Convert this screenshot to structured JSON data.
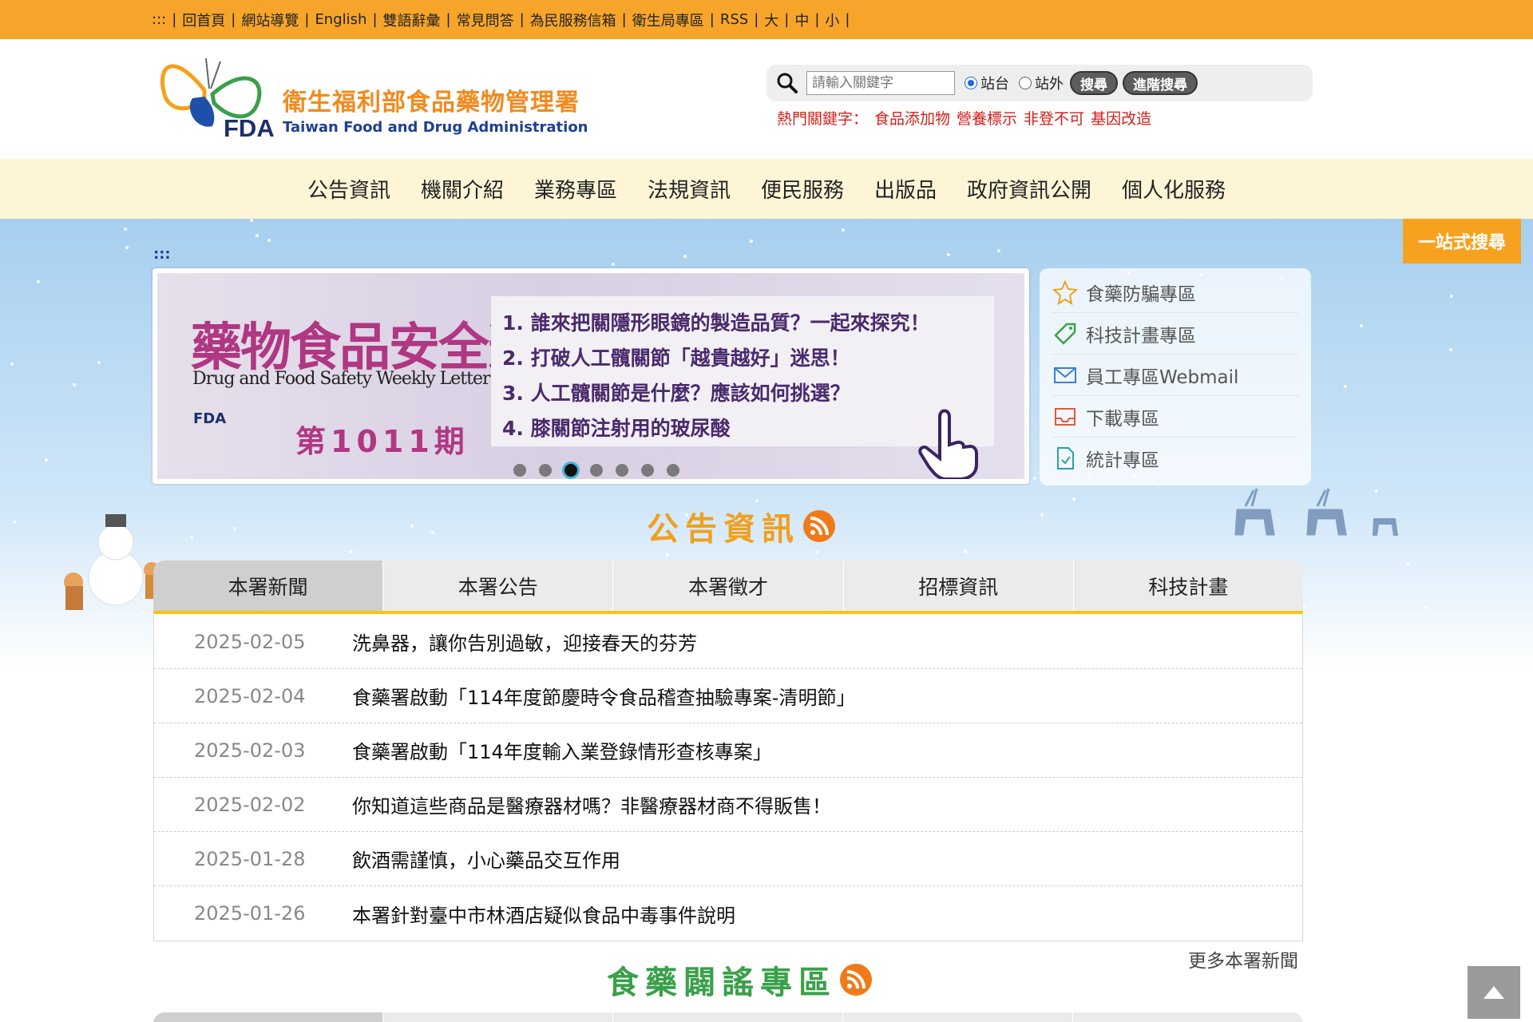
{
  "topbar": {
    "skip": ":::",
    "links": [
      "回首頁",
      "網站導覽",
      "English",
      "雙語辭彙",
      "常見問答",
      "為民服務信箱",
      "衛生局專區",
      "RSS",
      "大",
      "中",
      "小"
    ]
  },
  "logo": {
    "cn": "衛生福利部食品藥物管理署",
    "en": "Taiwan Food and Drug Administration",
    "fda": "FDA"
  },
  "search": {
    "placeholder": "請輸入關鍵字",
    "radio_site": "站台",
    "radio_external": "站外",
    "search_button": "搜尋",
    "advanced_button": "進階搜尋",
    "hot_label": "熱門關鍵字：",
    "hot_keywords": [
      "食品添加物",
      "營養標示",
      "非登不可",
      "基因改造"
    ]
  },
  "mainnav": [
    "公告資訊",
    "機關介紹",
    "業務專區",
    "法規資訊",
    "便民服務",
    "出版品",
    "政府資訊公開",
    "個人化服務"
  ],
  "skip_link": ":::",
  "onestop": "一站式搜尋",
  "banner": {
    "title": "藥物食品安全週報",
    "subtitle": "Drug and Food Safety Weekly Letter",
    "fda": "FDA",
    "issue": "第1011期",
    "items": [
      "1. 誰來把關隱形眼鏡的製造品質？一起來探究！",
      "2. 打破人工髖關節「越貴越好」迷思！",
      "3. 人工髖關節是什麼？應該如何挑選？",
      "4. 膝關節注射用的玻尿酸"
    ],
    "slide_count": 7,
    "active_slide": 3
  },
  "quicklinks": [
    {
      "label": "食藥防騙專區",
      "icon": "star-icon"
    },
    {
      "label": "科技計畫專區",
      "icon": "tag-icon"
    },
    {
      "label": "員工專區Webmail",
      "icon": "mail-icon"
    },
    {
      "label": "下載專區",
      "icon": "tray-icon"
    },
    {
      "label": "統計專區",
      "icon": "document-icon"
    }
  ],
  "announce": {
    "title": "公告資訊",
    "tabs": [
      "本署新聞",
      "本署公告",
      "本署徵才",
      "招標資訊",
      "科技計畫"
    ],
    "active_tab": 0,
    "news": [
      {
        "date": "2025-02-05",
        "title": "洗鼻器，讓你告別過敏，迎接春天的芬芳"
      },
      {
        "date": "2025-02-04",
        "title": "食藥署啟動「114年度節慶時令食品稽查抽驗專案-清明節」"
      },
      {
        "date": "2025-02-03",
        "title": "食藥署啟動「114年度輸入業登錄情形查核專案」"
      },
      {
        "date": "2025-02-02",
        "title": "你知道這些商品是醫療器材嗎？非醫療器材商不得販售！"
      },
      {
        "date": "2025-01-28",
        "title": "飲酒需謹慎，小心藥品交互作用"
      },
      {
        "date": "2025-01-26",
        "title": "本署針對臺中市林酒店疑似食品中毒事件說明"
      }
    ],
    "more": "更多本署新聞"
  },
  "rumor": {
    "title": "食藥闢謠專區"
  },
  "colors": {
    "topbar": "#f7a52a",
    "nav_bg": "#fdf5d6",
    "announce_title": "#f0a020",
    "rumor_title": "#3aa04a",
    "tab_underline": "#f2c714"
  }
}
